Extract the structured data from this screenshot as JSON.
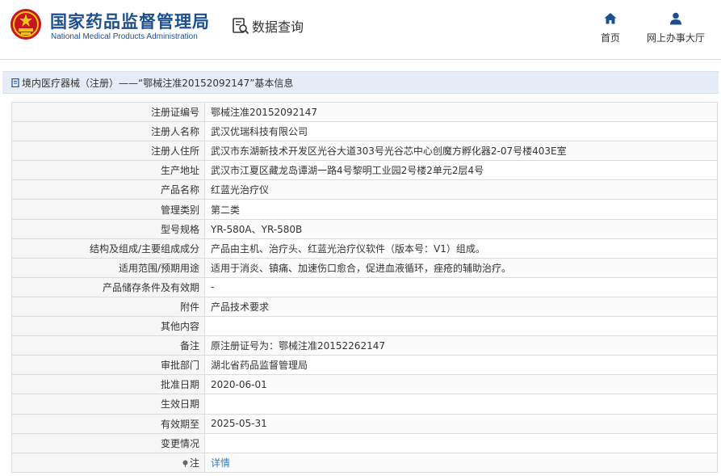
{
  "header": {
    "title_cn": "国家药品监督管理局",
    "title_en": "National Medical Products Administration",
    "query_label": "数据查询",
    "nav_home": "首页",
    "nav_service": "网上办事大厅"
  },
  "breadcrumb": "境内医疗器械（注册）——“鄂械注准20152092147”基本信息",
  "rows": [
    {
      "label": "注册证编号",
      "value": "鄂械注准20152092147"
    },
    {
      "label": "注册人名称",
      "value": "武汉优瑞科技有限公司"
    },
    {
      "label": "注册人住所",
      "value": "武汉市东湖新技术开发区光谷大道303号光谷芯中心创魔方孵化器2-07号楼403E室"
    },
    {
      "label": "生产地址",
      "value": "武汉市江夏区藏龙岛谭湖一路4号黎明工业园2号楼2单元2层4号"
    },
    {
      "label": "产品名称",
      "value": "红蓝光治疗仪"
    },
    {
      "label": "管理类别",
      "value": "第二类"
    },
    {
      "label": "型号规格",
      "value": "YR-580A、YR-580B"
    },
    {
      "label": "结构及组成/主要组成成分",
      "value": "产品由主机、治疗头、红蓝光治疗仪软件（版本号：V1）组成。"
    },
    {
      "label": "适用范围/预期用途",
      "value": "适用于消炎、镇痛、加速伤口愈合，促进血液循环，痤疮的辅助治疗。"
    },
    {
      "label": "产品储存条件及有效期",
      "value": "-"
    },
    {
      "label": "附件",
      "value": "产品技术要求"
    },
    {
      "label": "其他内容",
      "value": ""
    },
    {
      "label": "备注",
      "value": "原注册证号为：鄂械注准20152262147"
    },
    {
      "label": "审批部门",
      "value": "湖北省药品监督管理局"
    },
    {
      "label": "批准日期",
      "value": "2020-06-01"
    },
    {
      "label": "生效日期",
      "value": ""
    },
    {
      "label": "有效期至",
      "value": "2025-05-31"
    },
    {
      "label": "变更情况",
      "value": ""
    }
  ],
  "note": {
    "label": "注",
    "link": "详情"
  },
  "colors": {
    "brand": "#1d4f8f",
    "link": "#2f7bc2",
    "titlebar_bg": "#e4ecf5"
  }
}
